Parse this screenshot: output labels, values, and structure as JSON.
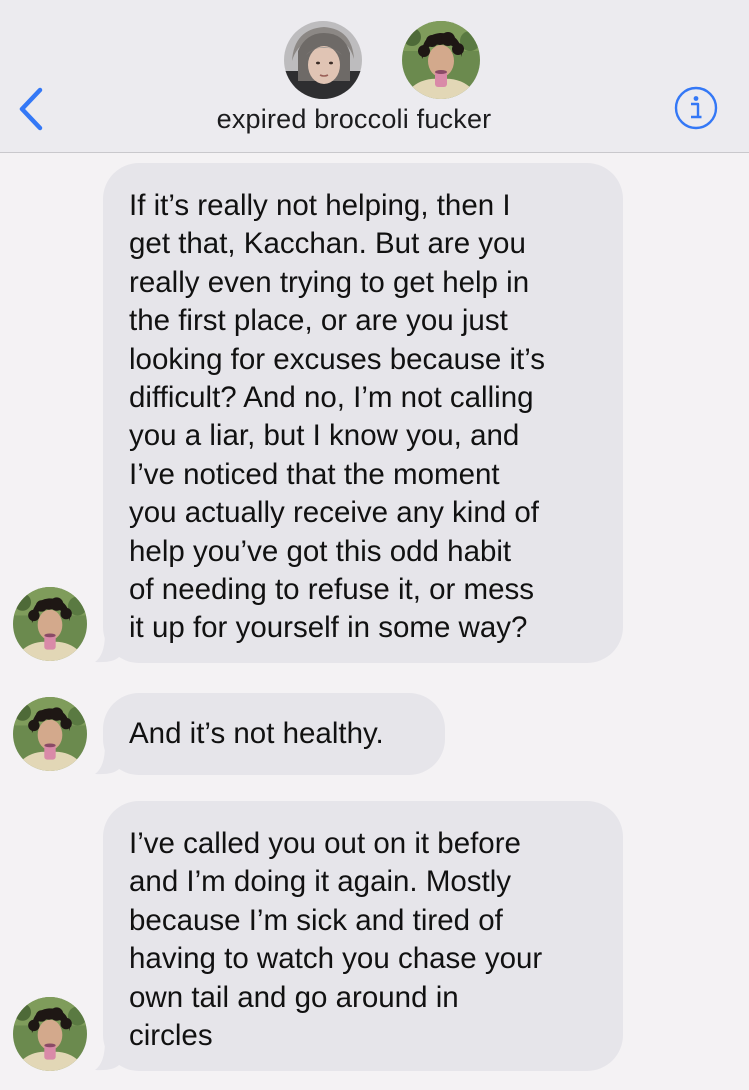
{
  "header": {
    "title": "expired broccoli fucker",
    "back_icon": "chevron-left-icon",
    "info_icon": "info-icon",
    "accent_color": "#3478f6",
    "participants": [
      "avatar-girl",
      "avatar-boy-curly"
    ]
  },
  "messages": [
    {
      "sender": "avatar-boy-curly",
      "text": "If it’s really not helping, then I\nget that, Kacchan. But are you\nreally even trying to get help in\nthe first place, or are you just\nlooking for excuses because it’s\ndifficult? And no, I’m not calling\nyou a liar, but I know you, and\nI’ve noticed that the moment\nyou actually receive any kind of\nhelp you’ve got this odd habit\nof needing to refuse it, or mess\nit up for yourself in some way?"
    },
    {
      "sender": "avatar-boy-curly",
      "text": "And it’s not healthy."
    },
    {
      "sender": "avatar-boy-curly",
      "text": "I’ve called you out on it before\nand I’m doing it again. Mostly\nbecause I’m sick and tired of\nhaving to watch you chase your\nown tail and go around in\ncircles"
    }
  ],
  "bubble_color": "#e6e5ea"
}
